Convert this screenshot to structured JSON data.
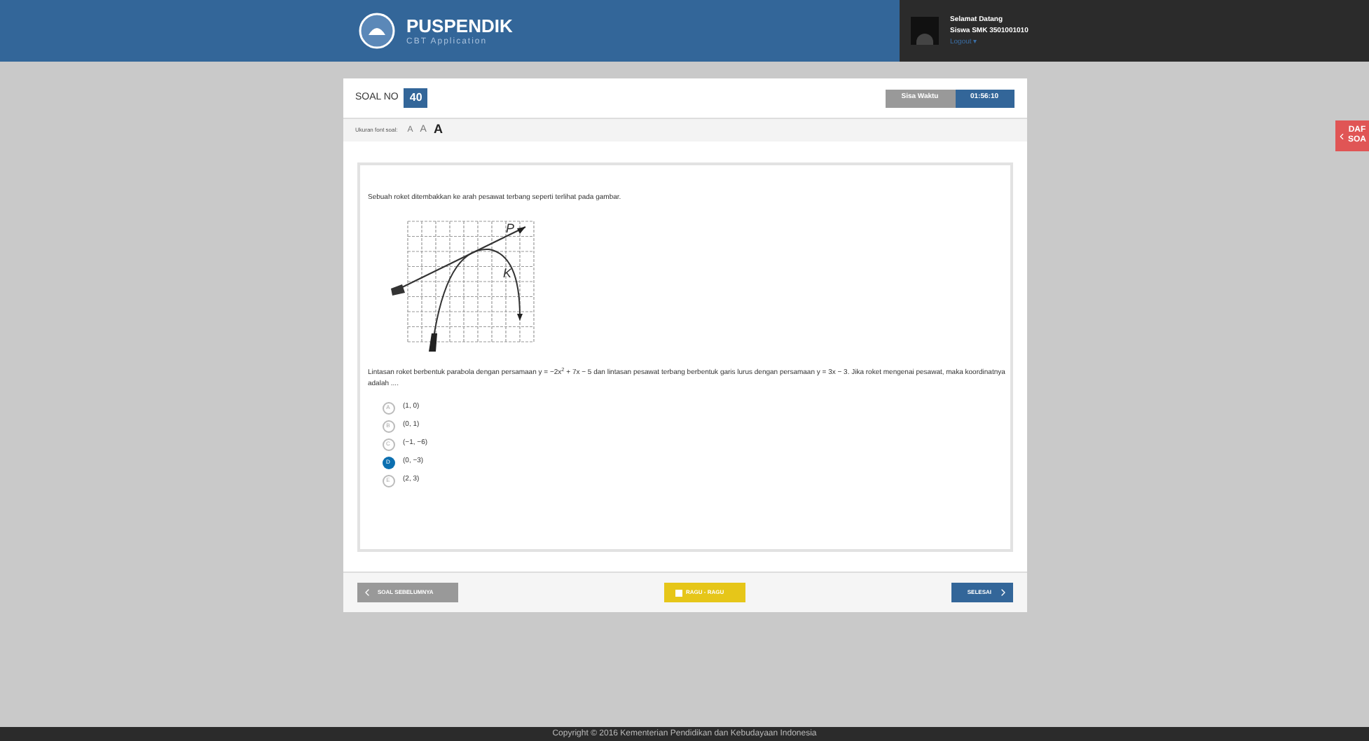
{
  "header": {
    "brand": "PUSPENDIK",
    "subtitle": "CBT Application",
    "greeting": "Selamat Datang",
    "user": "Siswa SMK 3501001010",
    "logout": "Logout ▾"
  },
  "question_header": {
    "label": "SOAL NO",
    "number": "40",
    "timer_label": "Sisa Waktu",
    "timer": "01:56:10"
  },
  "font_size": {
    "label": "Ukuran font soal:",
    "options": [
      {
        "label": "A",
        "selected": false
      },
      {
        "label": "A",
        "selected": false
      },
      {
        "label": "A",
        "selected": true
      }
    ]
  },
  "question": {
    "intro": "Sebuah roket ditembakkan ke arah pesawat terbang seperti terlihat pada gambar.",
    "figure_labels": [
      "P",
      "K"
    ],
    "text": "Lintasan roket berbentuk parabola dengan persamaan y = −2x$^{2}$ + 7x − 5 dan lintasan pesawat terbang berbentuk garis lurus dengan persamaan y = 3x − 3. Jika roket mengenai pesawat, maka koordinatnya adalah ....",
    "options": [
      {
        "letter": "A",
        "text": "(1, 0)",
        "selected": false
      },
      {
        "letter": "B",
        "text": "(0, 1)",
        "selected": false
      },
      {
        "letter": "C",
        "text": "(−1, −6)",
        "selected": false
      },
      {
        "letter": "D",
        "text": "(0, −3)",
        "selected": true
      },
      {
        "letter": "E",
        "text": "(2, 3)",
        "selected": false
      }
    ]
  },
  "nav": {
    "prev": "SOAL SEBELUMNYA",
    "doubt": "RAGU - RAGU",
    "doubt_checked": false,
    "next": "SELESAI"
  },
  "side_tab": {
    "lines": [
      "DAF",
      "SOA"
    ]
  },
  "footer": "Copyright © 2016 Kementerian Pendidikan dan Kebudayaan Indonesia"
}
